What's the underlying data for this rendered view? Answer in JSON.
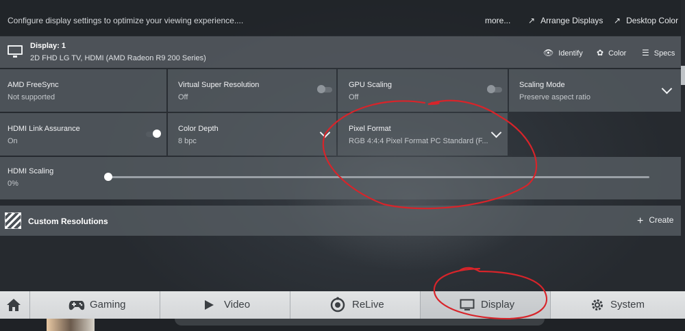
{
  "topbar": {
    "description": "Configure display settings to optimize your viewing experience....",
    "more_label": "more...",
    "arrange_label": "Arrange Displays",
    "desktop_color_label": "Desktop Color"
  },
  "display": {
    "title": "Display: 1",
    "subtitle": "2D FHD LG TV, HDMI (AMD Radeon R9 200 Series)",
    "identify_label": "Identify",
    "color_label": "Color",
    "specs_label": "Specs"
  },
  "settings": {
    "freesync": {
      "label": "AMD FreeSync",
      "value": "Not supported"
    },
    "vsr": {
      "label": "Virtual Super Resolution",
      "value": "Off",
      "toggle": "off"
    },
    "gpu_scaling": {
      "label": "GPU Scaling",
      "value": "Off",
      "toggle": "off"
    },
    "scaling_mode": {
      "label": "Scaling Mode",
      "value": "Preserve aspect ratio"
    },
    "hdmi_link": {
      "label": "HDMI Link Assurance",
      "value": "On",
      "toggle": "on"
    },
    "color_depth": {
      "label": "Color Depth",
      "value": "8 bpc"
    },
    "pixel_format": {
      "label": "Pixel Format",
      "value": "RGB 4:4:4 Pixel Format PC Standard (F..."
    },
    "hdmi_scaling": {
      "label": "HDMI Scaling",
      "value": "0%",
      "level": 0
    }
  },
  "custom_resolutions": {
    "title": "Custom Resolutions",
    "create_label": "Create"
  },
  "nav": {
    "gaming": "Gaming",
    "video": "Video",
    "relive": "ReLive",
    "display": "Display",
    "system": "System"
  },
  "annotation_color": "#d8242a"
}
